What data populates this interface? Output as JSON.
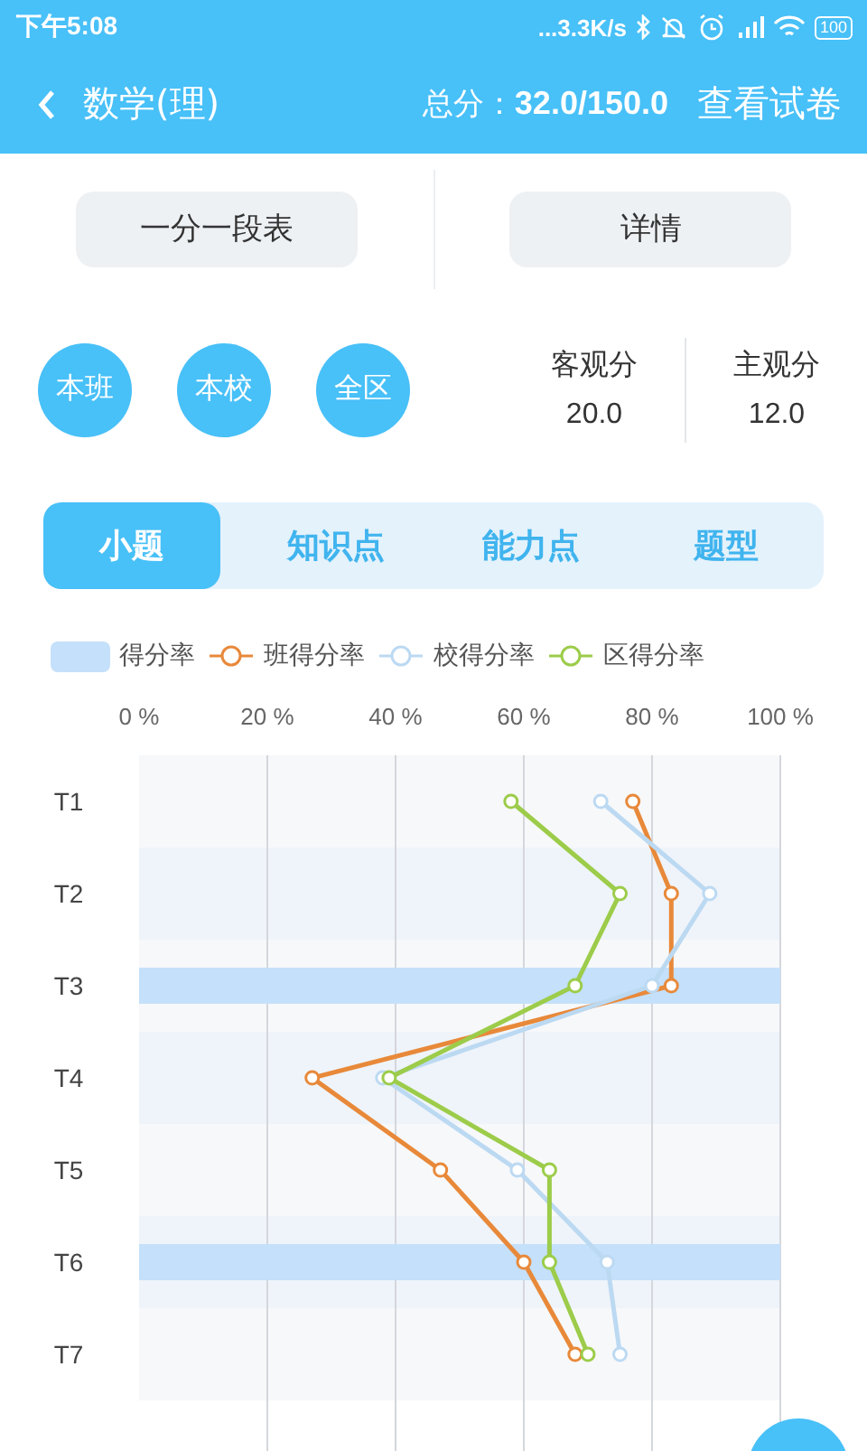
{
  "status_bar": {
    "time": "下午5:08",
    "network_speed": "...3.3K/s",
    "battery": "100"
  },
  "header": {
    "title": "数学(理)",
    "total_score": "总分：**32.0/150.0**",
    "action": "查看试卷"
  },
  "buttons": [
    "一分一段表",
    "详情"
  ],
  "scopes": [
    {
      "label": "本班"
    },
    {
      "label": "本校"
    },
    {
      "label": "全区"
    }
  ],
  "scores": [
    {
      "label": "客观分",
      "value": "20.0"
    },
    {
      "label": "主观分",
      "value": "12.0"
    }
  ],
  "tabs": [
    {
      "label": "小题",
      "selected": true
    },
    {
      "label": "知识点",
      "selected": false
    },
    {
      "label": "能力点",
      "selected": false
    },
    {
      "label": "题型",
      "selected": false
    }
  ],
  "chart_data": {
    "type": "bar",
    "orientation": "horizontal",
    "grid": true,
    "categories": [
      "T1",
      "T2",
      "T3",
      "T4",
      "T5",
      "T6",
      "T7"
    ],
    "xlim": [
      0,
      100
    ],
    "xticks": [
      {
        "value": 0,
        "label": "0 %"
      },
      {
        "value": 20,
        "label": "20 %"
      },
      {
        "value": 40,
        "label": "40 %"
      },
      {
        "value": 60,
        "label": "60 %"
      },
      {
        "value": 80,
        "label": "80 %"
      },
      {
        "value": 100,
        "label": "100 %"
      }
    ],
    "series": [
      {
        "name": "得分率",
        "type": "bar",
        "color": "#c4e0fa",
        "values": [
          0,
          0,
          100,
          0,
          0,
          100,
          0
        ]
      },
      {
        "name": "班得分率",
        "type": "line",
        "marker": "circle",
        "color": "#e8893a",
        "values": [
          77,
          83,
          83,
          27,
          47,
          60,
          68
        ]
      },
      {
        "name": "校得分率",
        "type": "line",
        "marker": "circle",
        "color": "#bcd9f2",
        "values": [
          72,
          89,
          80,
          38,
          59,
          73,
          75
        ]
      },
      {
        "name": "区得分率",
        "type": "line",
        "marker": "circle",
        "color": "#9ccc4a",
        "values": [
          58,
          75,
          68,
          39,
          64,
          64,
          70
        ]
      }
    ]
  }
}
